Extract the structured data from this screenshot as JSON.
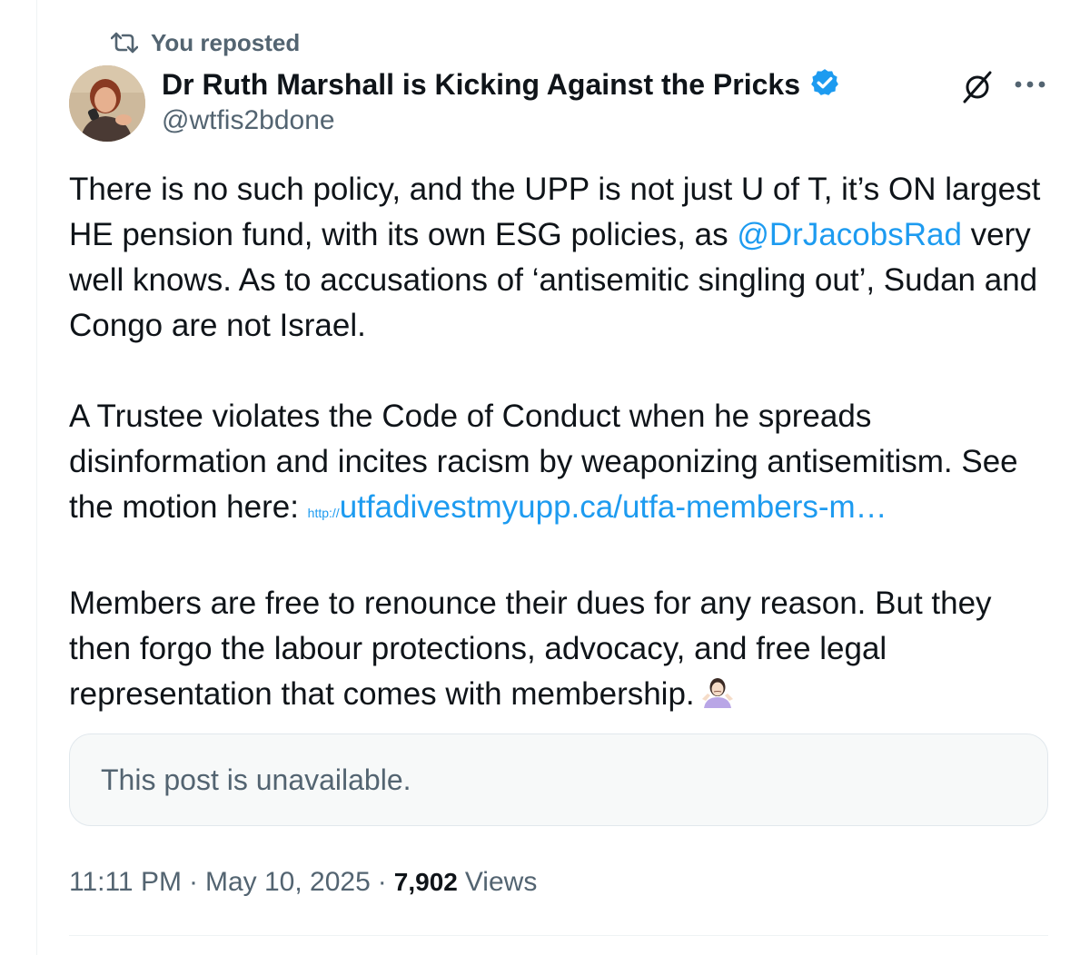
{
  "repost_indicator": {
    "icon": "repost-icon",
    "label": "You reposted"
  },
  "author": {
    "display_name": "Dr Ruth Marshall is Kicking Against the Pricks",
    "handle": "@wtfis2bdone",
    "verified": true,
    "verified_color": "#1d9bf0"
  },
  "header_actions": {
    "grok_icon": "grok-icon",
    "more_icon": "more-dots-icon"
  },
  "tweet": {
    "paragraph1_a": "There is no such policy, and the UPP is not just U of T, it’s ON largest HE pension fund, with its own ESG policies, as ",
    "mention": "@DrJacobsRad",
    "paragraph1_b": " very well knows. As to accusations of ‘antisemitic singling out’, Sudan and Congo are not Israel.",
    "paragraph2_a": "A Trustee violates the Code of Conduct when he spreads disinformation and incites racism by weaponizing antisemitism. See the motion here: ",
    "link_prefix": "http://",
    "link_text": "utfadivestmyupp.ca/utfa-members-m…",
    "paragraph3": "Members are free to renounce their dues for any reason. But they then forgo the labour protections, advocacy, and free legal representation that comes with membership.",
    "emoji": "person-shrugging-emoji"
  },
  "quote": {
    "text": "This post is unavailable."
  },
  "meta": {
    "time": "11:11 PM",
    "separator": "·",
    "date": "May 10, 2025",
    "views_count": "7,902",
    "views_label": "Views"
  },
  "colors": {
    "text_primary": "#0f1419",
    "text_secondary": "#536471",
    "link": "#1d9bf0",
    "quote_bg": "#f7f9f9",
    "border": "#e1e8ed"
  }
}
